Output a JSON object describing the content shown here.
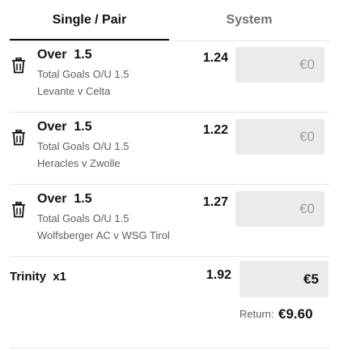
{
  "tabs": {
    "single_pair": "Single / Pair",
    "system": "System",
    "active": "single_pair"
  },
  "bets": [
    {
      "market": "Over  1.5",
      "subtitle": "Total Goals O/U 1.5",
      "event": "Levante v Celta",
      "odds": "1.24",
      "stake_placeholder": "€0"
    },
    {
      "market": "Over  1.5",
      "subtitle": "Total Goals O/U 1.5",
      "event": "Heracles v Zwolle",
      "odds": "1.22",
      "stake_placeholder": "€0"
    },
    {
      "market": "Over  1.5",
      "subtitle": "Total Goals O/U 1.5",
      "event": "Wolfsberger AC v WSG Tirol",
      "odds": "1.27",
      "stake_placeholder": "€0"
    }
  ],
  "trinity": {
    "label": "Trinity  x1",
    "odds": "1.92",
    "stake": "€5",
    "return_label": "Return:",
    "return_value": "€9.60"
  },
  "icons": {
    "delete": "trash-icon"
  },
  "colors": {
    "text_primary": "#111111",
    "text_secondary": "#5b6068",
    "tab_inactive": "#6b6f76",
    "input_bg": "#ebebeb",
    "placeholder": "#9b9ea3",
    "divider": "#e6e6e6"
  }
}
